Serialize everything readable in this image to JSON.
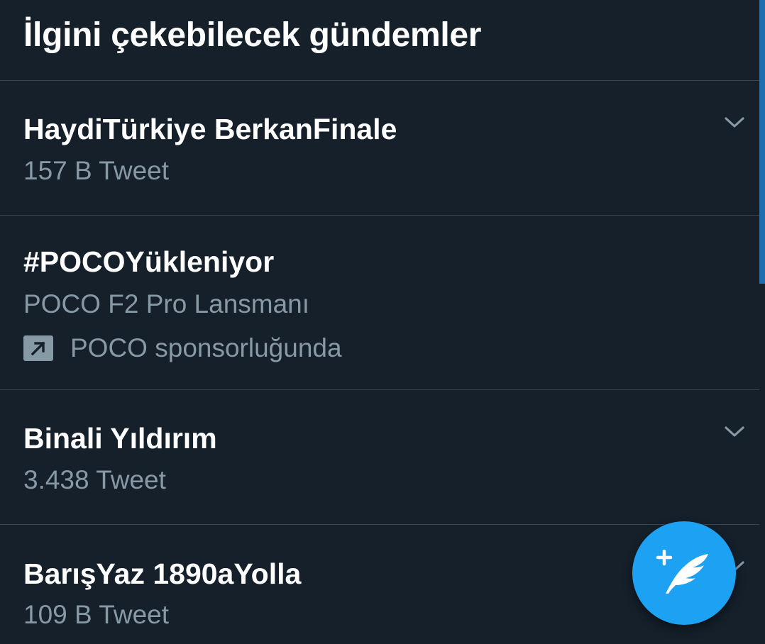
{
  "header": {
    "title": "İlgini çekebilecek gündemler"
  },
  "trends": [
    {
      "title": "HaydiTürkiye BerkanFinale",
      "subtitle": "157 B Tweet",
      "has_menu": true
    },
    {
      "title": "#POCOYükleniyor",
      "subtitle": "POCO F2 Pro Lansmanı",
      "promoted_label": "POCO sponsorluğunda",
      "promoted_icon": "promoted-arrow-icon",
      "has_menu": false
    },
    {
      "title": "Binali Yıldırım",
      "subtitle": "3.438 Tweet",
      "has_menu": true
    },
    {
      "title": "BarışYaz 1890aYolla",
      "subtitle": "109 B Tweet",
      "has_menu": true
    }
  ],
  "compose_button": {
    "icon": "compose-tweet-icon"
  },
  "colors": {
    "background": "#15202b",
    "divider": "#38444d",
    "primary_text": "#ffffff",
    "secondary_text": "#8899a6",
    "accent": "#1da1f2"
  }
}
